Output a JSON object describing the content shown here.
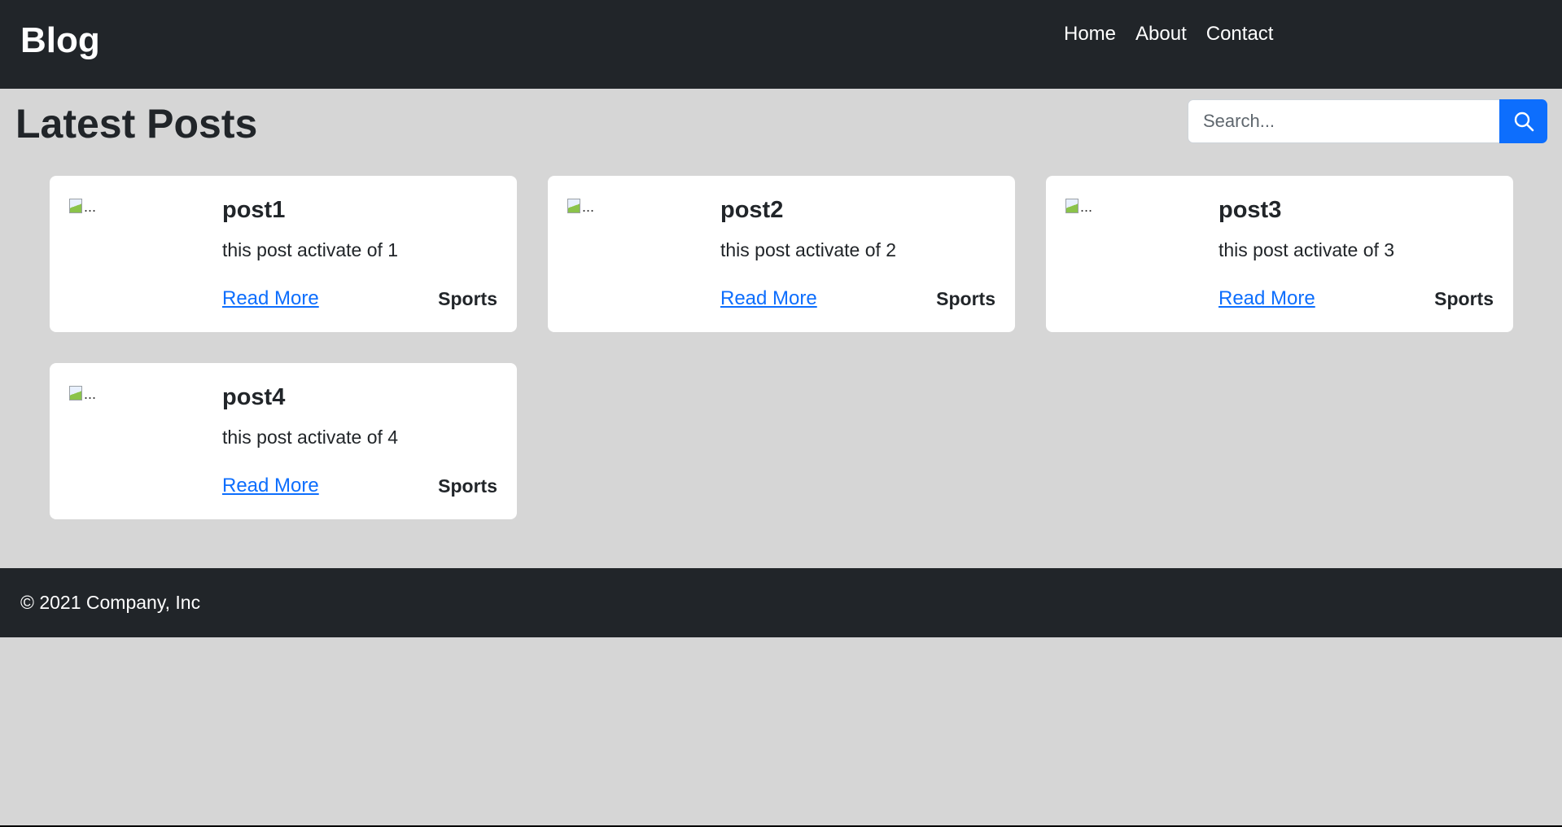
{
  "navbar": {
    "brand": "Blog",
    "links": [
      "Home",
      "About",
      "Contact"
    ]
  },
  "main": {
    "title": "Latest Posts",
    "search": {
      "placeholder": "Search..."
    },
    "posts": [
      {
        "image_alt": "...",
        "title": "post1",
        "text": "this post activate of 1",
        "link": "Read More",
        "category": "Sports"
      },
      {
        "image_alt": "...",
        "title": "post2",
        "text": "this post activate of 2",
        "link": "Read More",
        "category": "Sports"
      },
      {
        "image_alt": "...",
        "title": "post3",
        "text": "this post activate of 3",
        "link": "Read More",
        "category": "Sports"
      },
      {
        "image_alt": "...",
        "title": "post4",
        "text": "this post activate of 4",
        "link": "Read More",
        "category": "Sports"
      }
    ]
  },
  "footer": {
    "text": "© 2021 Company, Inc"
  },
  "icons": {
    "search": "search-icon",
    "broken_image": "broken-image-icon"
  },
  "colors": {
    "navbar": "#212529",
    "background": "#d6d6d6",
    "primary": "#0d6efd",
    "card": "#ffffff"
  }
}
